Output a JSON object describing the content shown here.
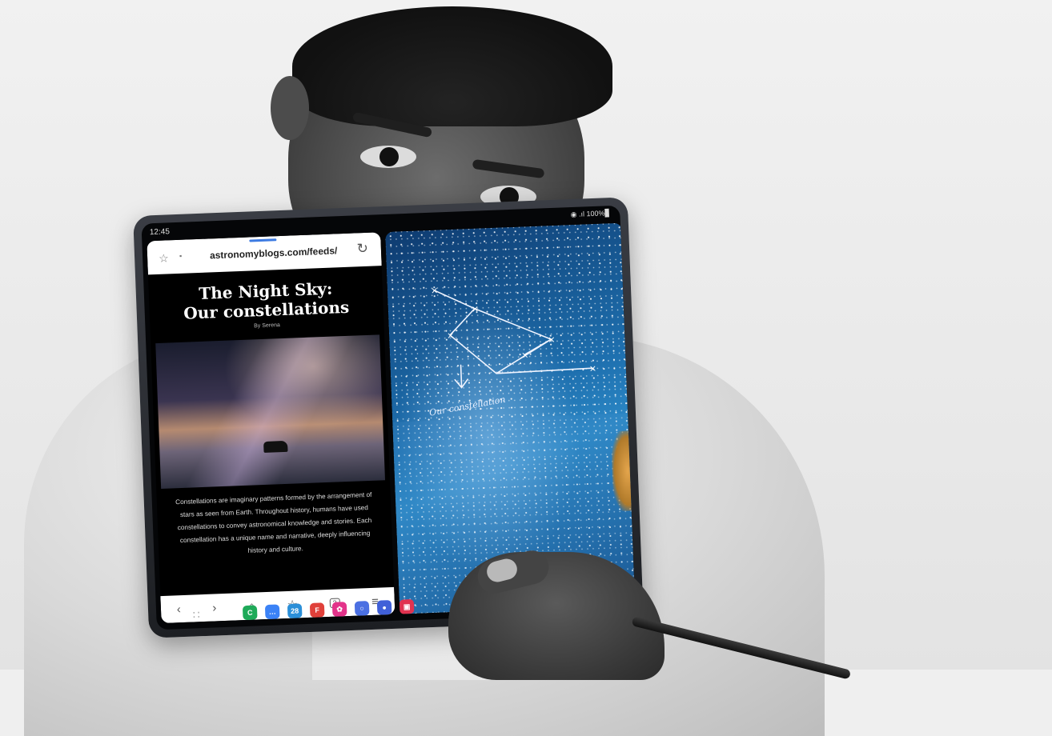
{
  "status_bar": {
    "time": "12:45",
    "signal_battery": "◉ .ıl 100%▊"
  },
  "browser": {
    "url": "astronomyblogs.com/feeds/",
    "star_icon": "☆",
    "lock_icon": "▪",
    "reload_icon": "↻",
    "article": {
      "title_line1": "The Night Sky:",
      "title_line2": "Our constellations",
      "byline": "By Serena",
      "body": "Constellations are imaginary patterns formed by the arrangement of stars as seen from Earth. Throughout history, humans have used constellations to convey astronomical knowledge and stories. Each constellation has a unique name and narrative, deeply influencing history and culture."
    },
    "nav": [
      {
        "name": "back-icon",
        "glyph": "‹"
      },
      {
        "name": "forward-icon",
        "glyph": "›"
      },
      {
        "name": "home-icon",
        "glyph": "⌂"
      },
      {
        "name": "bookmark-icon",
        "glyph": "☆"
      },
      {
        "name": "tabs-icon",
        "glyph": "3"
      },
      {
        "name": "menu-icon",
        "glyph": "≡"
      }
    ]
  },
  "sketch": {
    "handwriting": "Our constellation"
  },
  "taskbar": {
    "apps_grid_icon": "∷",
    "apps": [
      {
        "name": "phone-app-icon",
        "glyph": "C",
        "color": "#1faa59"
      },
      {
        "name": "messages-app-icon",
        "glyph": "…",
        "color": "#3b82f6"
      },
      {
        "name": "calendar-app-icon",
        "glyph": "28",
        "color": "#2b8fd8"
      },
      {
        "name": "flipboard-app-icon",
        "glyph": "F",
        "color": "#e0403a"
      },
      {
        "name": "bixby-app-icon",
        "glyph": "✿",
        "color": "#e3338a"
      },
      {
        "name": "flow-app-icon",
        "glyph": "○",
        "color": "#4b70e2"
      },
      {
        "name": "screen-recorder-app-icon",
        "glyph": "●",
        "color": "#4060d8"
      },
      {
        "name": "camera-app-icon",
        "glyph": "▣",
        "color": "#e03350"
      }
    ]
  }
}
